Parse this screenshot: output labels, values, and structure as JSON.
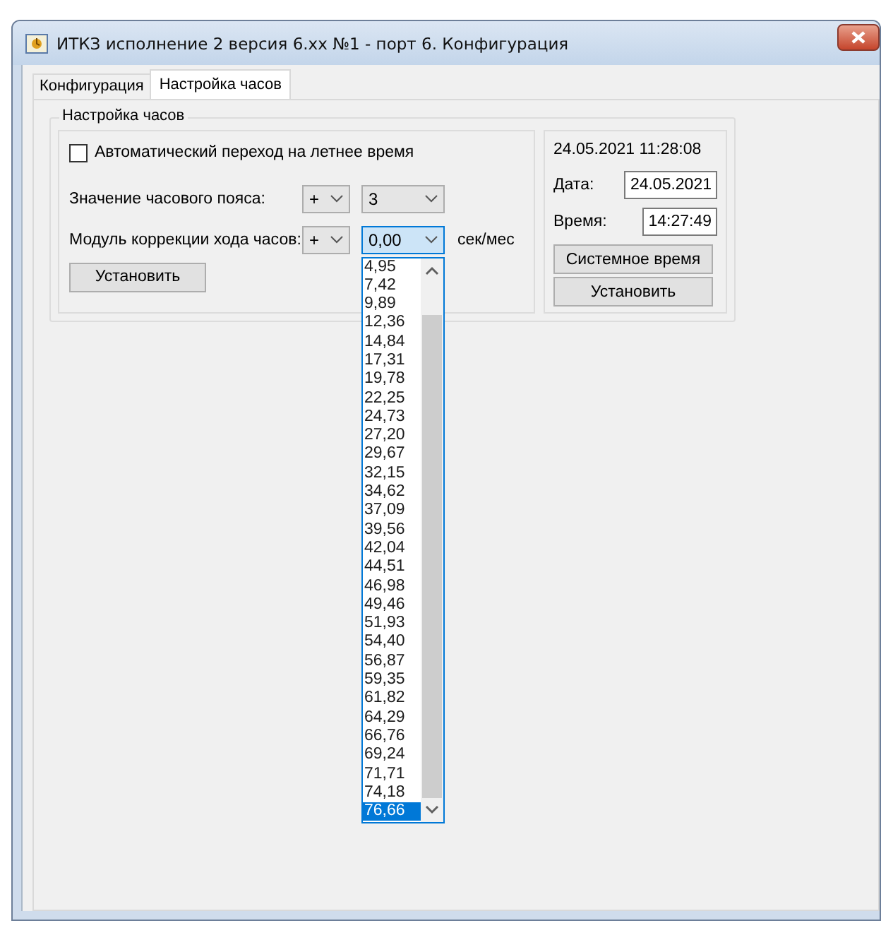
{
  "window": {
    "title": "ИТКЗ исполнение 2 версия 6.xx №1 - порт 6. Конфигурация"
  },
  "tabs": [
    {
      "label": "Конфигурация",
      "selected": false
    },
    {
      "label": "Настройка часов",
      "selected": true
    }
  ],
  "clock_group": {
    "title": "Настройка часов",
    "dst_checkbox": {
      "label": "Автоматический переход на летнее время",
      "checked": false
    },
    "timezone": {
      "label": "Значение часового пояса:",
      "sign": "+",
      "value": "3",
      "expanded": false
    },
    "correction": {
      "label": "Модуль коррекции хода часов:",
      "sign": "+",
      "value": "0,00",
      "unit": "сек/мес",
      "expanded": true,
      "options": [
        {
          "label": "4,95",
          "selected": false
        },
        {
          "label": "7,42",
          "selected": false
        },
        {
          "label": "9,89",
          "selected": false
        },
        {
          "label": "12,36",
          "selected": false
        },
        {
          "label": "14,84",
          "selected": false
        },
        {
          "label": "17,31",
          "selected": false
        },
        {
          "label": "19,78",
          "selected": false
        },
        {
          "label": "22,25",
          "selected": false
        },
        {
          "label": "24,73",
          "selected": false
        },
        {
          "label": "27,20",
          "selected": false
        },
        {
          "label": "29,67",
          "selected": false
        },
        {
          "label": "32,15",
          "selected": false
        },
        {
          "label": "34,62",
          "selected": false
        },
        {
          "label": "37,09",
          "selected": false
        },
        {
          "label": "39,56",
          "selected": false
        },
        {
          "label": "42,04",
          "selected": false
        },
        {
          "label": "44,51",
          "selected": false
        },
        {
          "label": "46,98",
          "selected": false
        },
        {
          "label": "49,46",
          "selected": false
        },
        {
          "label": "51,93",
          "selected": false
        },
        {
          "label": "54,40",
          "selected": false
        },
        {
          "label": "56,87",
          "selected": false
        },
        {
          "label": "59,35",
          "selected": false
        },
        {
          "label": "61,82",
          "selected": false
        },
        {
          "label": "64,29",
          "selected": false
        },
        {
          "label": "66,76",
          "selected": false
        },
        {
          "label": "69,24",
          "selected": false
        },
        {
          "label": "71,71",
          "selected": false
        },
        {
          "label": "74,18",
          "selected": false
        },
        {
          "label": "76,66",
          "selected": true
        }
      ]
    },
    "set_button": "Установить"
  },
  "device_clock": {
    "datetime": "24.05.2021 11:28:08",
    "date_label": "Дата:",
    "date_value": "24.05.2021",
    "time_label": "Время:",
    "time_value": "14:27:49",
    "buttons": [
      "Системное время",
      "Установить"
    ]
  }
}
